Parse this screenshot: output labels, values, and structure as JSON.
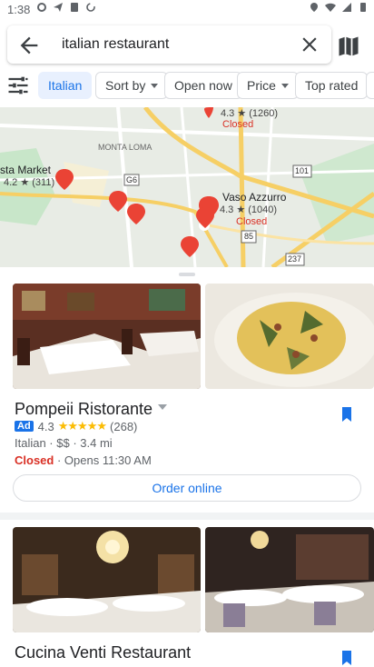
{
  "status_bar": {
    "time": "1:38"
  },
  "search": {
    "query": "italian restaurant"
  },
  "chips": [
    {
      "label": "Italian",
      "active": true
    },
    {
      "label": "Sort by",
      "dropdown": true
    },
    {
      "label": "Open now"
    },
    {
      "label": "Price",
      "dropdown": true
    },
    {
      "label": "Top rated"
    }
  ],
  "map": {
    "labels": {
      "top_rating": "4.3 ★ (1260)",
      "montaloma": "MONTA LOMA",
      "costa_market": "sta Market",
      "costa_rating": "4.2 ★ (311)",
      "vaso_name": "Vaso Azzurro",
      "vaso_rating": "4.3 ★ (1040)",
      "vaso_status": "Closed",
      "top_status": "Closed",
      "g6": "G6",
      "h101": "101",
      "h85": "85",
      "h237": "237"
    }
  },
  "results": [
    {
      "name": "Pompeii Ristorante",
      "ad_label": "Ad",
      "rating": "4.3",
      "stars": "★★★★★",
      "reviews": "(268)",
      "details": "Italian · $$ · 3.4 mi",
      "status": "Closed",
      "hours": "· Opens 11:30 AM",
      "action": "Order online"
    },
    {
      "name": "Cucina Venti Restaurant"
    }
  ],
  "colors": {
    "accent": "#1a73e8",
    "closed": "#d93025",
    "star": "#fbbc04",
    "pin": "#ea4335"
  }
}
